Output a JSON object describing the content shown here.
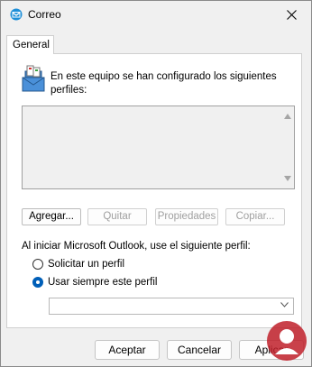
{
  "window": {
    "title": "Correo",
    "icon": "mail-app-icon"
  },
  "tabs": [
    {
      "label": "General",
      "active": true
    }
  ],
  "info": {
    "text": "En este equipo se han configurado los siguientes perfiles:"
  },
  "profile_list": {
    "items": []
  },
  "profile_buttons": {
    "add": "Agregar...",
    "remove": "Quitar",
    "properties": "Propiedades",
    "copy": "Copiar..."
  },
  "startup": {
    "label": "Al iniciar Microsoft Outlook, use el siguiente perfil:",
    "option_prompt": "Solicitar un perfil",
    "option_always": "Usar siempre este perfil",
    "selected_option": "option_always",
    "profile_select_value": ""
  },
  "footer_buttons": {
    "accept": "Aceptar",
    "cancel": "Cancelar",
    "apply": "Aplicar"
  },
  "colors": {
    "accent": "#005fb8",
    "disabled_text": "#a0a0a0",
    "watermark": "#c0202a"
  }
}
